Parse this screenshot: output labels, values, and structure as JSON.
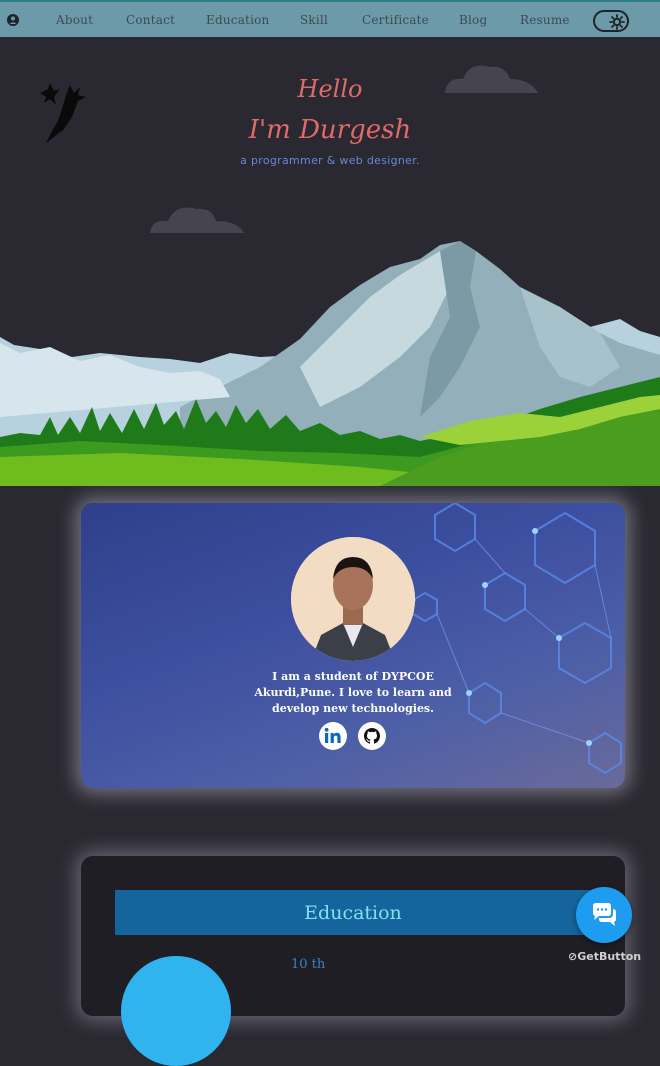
{
  "nav": {
    "items": [
      "About",
      "Contact",
      "Education",
      "Skill",
      "Certificate",
      "Blog",
      "Resume"
    ]
  },
  "hero": {
    "hello": "Hello",
    "name": "I'm Durgesh",
    "tagline": "a programmer & web designer."
  },
  "profile": {
    "bio": "I am a student of DYPCOE Akurdi,Pune. I love to learn and develop new technologies.",
    "social": [
      "linkedin-icon",
      "github-icon"
    ]
  },
  "education": {
    "title": "Education",
    "first_year": "10 th"
  },
  "chat": {
    "brand": "GetButton"
  }
}
